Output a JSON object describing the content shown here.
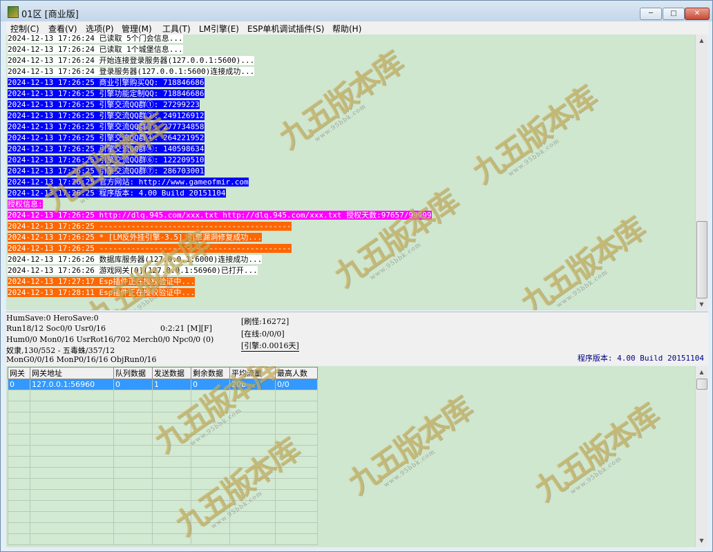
{
  "window": {
    "title": "01区 [商业版]",
    "minimize": "─",
    "maximize": "□",
    "close": "✕"
  },
  "menu": [
    "控制(C)",
    "查看(V)",
    "选项(P)",
    "管理(M)",
    "工具(T)",
    "LM引擎(E)",
    "ESP单机调试插件(S)",
    "帮助(H)"
  ],
  "log": [
    {
      "text": "2024-12-13 17:26:24 已读取 5个门会信息...",
      "style": "c-w"
    },
    {
      "text": "2024-12-13 17:26:24 已读取 1个城堡信息...",
      "style": "c-w"
    },
    {
      "text": "2024-12-13 17:26:24 开始连接登录服务器(127.0.0.1:5600)...",
      "style": "c-w"
    },
    {
      "text": "2024-12-13 17:26:24 登录服务器(127.0.0.1:5600)连接成功...",
      "style": "c-w"
    },
    {
      "text": "2024-12-13 17:26:25 商业引擎购买QQ: 718846686",
      "style": "c-b"
    },
    {
      "text": "2024-12-13 17:26:25 引擎功能定制QQ: 718846686",
      "style": "c-b"
    },
    {
      "text": "2024-12-13 17:26:25 引擎交流QQ群①: 27299223",
      "style": "c-b"
    },
    {
      "text": "2024-12-13 17:26:25 引擎交流QQ群②: 249126912",
      "style": "c-b"
    },
    {
      "text": "2024-12-13 17:26:25 引擎交流QQ群③: 277734858",
      "style": "c-b"
    },
    {
      "text": "2024-12-13 17:26:25 引擎交流QQ群④: 264221952",
      "style": "c-b"
    },
    {
      "text": "2024-12-13 17:26:25 引擎交流QQ群④: 140598634",
      "style": "c-b"
    },
    {
      "text": "2024-12-13 17:26:25 引擎交流QQ群⑥: 122209510",
      "style": "c-b"
    },
    {
      "text": "2024-12-13 17:26:25 引擎交流QQ群⑦: 286703001",
      "style": "c-b"
    },
    {
      "text": "2024-12-13 17:26:25 官方网站: http://www.gameofmir.com",
      "style": "c-b"
    },
    {
      "text": "2024-12-13 17:26:25 程序版本: 4.00 Build 20151104",
      "style": "c-b"
    },
    {
      "text": "授权信息:",
      "style": "c-m"
    },
    {
      "text": "2024-12-13 17:26:25 http://dlq.945.com/xxx.txt http://dlq.945.com/xxx.txt 授权天数:97657/99999",
      "style": "c-m"
    },
    {
      "text": "2024-12-13 17:26:25 ------------------------------------------",
      "style": "c-o"
    },
    {
      "text": "2024-12-13 17:26:25 * [LM反外挂引擎-3.5] 引擎漏洞修复成功...",
      "style": "c-o"
    },
    {
      "text": "2024-12-13 17:26:25 ------------------------------------------",
      "style": "c-o"
    },
    {
      "text": "2024-12-13 17:26:26 数据库服务器(127.0.0.1:6000)连接成功...",
      "style": "c-w"
    },
    {
      "text": "2024-12-13 17:26:26 游戏网关[0](127.0.0.1:56960)已打开...",
      "style": "c-w"
    },
    {
      "text": "2024-12-13 17:27:17 Esp插件正在授权验证中...",
      "style": "c-o"
    },
    {
      "text": "2024-12-13 17:28:11 Esp插件正在授权验证中...",
      "style": "c-o"
    }
  ],
  "status": {
    "line1": "HumSave:0 HeroSave:0",
    "line2": "Run18/12 Soc0/0 Usr0/16",
    "time": "0:2:21 [M][F]",
    "line3": "Hum0/0 Mon0/16 UsrRot16/702 Merch0/0 Npc0/0 (0)",
    "line4": "奴隶,130/552 - 五毒蛛/357/12",
    "line5": "MonG0/0/16 MonP0/16/16 ObjRun0/16",
    "refresh": "[刷怪:16272]",
    "online": "[在线:0/0/0]",
    "engine": "[引擎:0.0016天]",
    "version": "程序版本: 4.00 Build 20151104"
  },
  "gate_table": {
    "headers": [
      "网关",
      "网关地址",
      "队列数据",
      "发送数据",
      "剩余数据",
      "平均流量",
      "最高人数"
    ],
    "rows": [
      [
        "0",
        "127.0.0.1:56960",
        "0",
        "1",
        "0",
        "20b",
        "0/0"
      ]
    ],
    "empty_rows": 14
  },
  "watermark": {
    "text": "九五版本库",
    "url": "www.95bbk.com"
  }
}
